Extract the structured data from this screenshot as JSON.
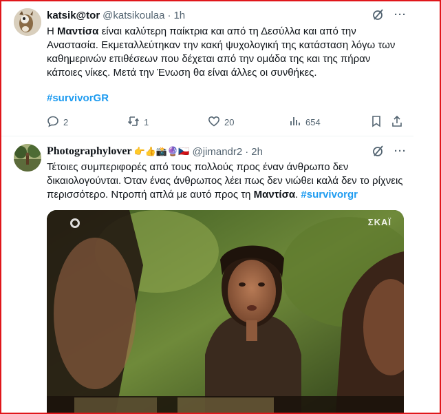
{
  "tweets": [
    {
      "display_name": "katsik@tor",
      "handle": "@katsikoulaa",
      "dot": "·",
      "time": "1h",
      "text": {
        "p1": "Η ",
        "bold1": "Μαντίσα",
        "p2": " είναι καλύτερη παίκτρια και από τη Δεσύλλα και από την Αναστασία. Εκμεταλλεύτηκαν την κακή ψυχολογική της κατάσταση λόγω των  καθημερινών επιθέσεων που δέχεται από την ομάδα της και της πήραν κάποιες νίκες. Μετά την Ένωση θα είναι άλλες οι συνθήκες."
      },
      "hashtag": "#survivorGR",
      "stats": {
        "replies": "2",
        "reposts": "1",
        "likes": "20",
        "views": "654"
      }
    },
    {
      "display_name": "Photographylover",
      "emojis": "👉👍📸🔮🇨🇿",
      "handle": "@jimandr2",
      "dot": "·",
      "time": "2h",
      "text": {
        "p1": "Τέτοιες συμπεριφορές από τους πολλούς προς έναν άνθρωπο δεν δικαιολογούνται. Όταν ένας άνθρωπος λέει πως δεν νιώθει καλά δεν το ρίχνεις περισσότερο. Ντροπή απλά με αυτό προς τη ",
        "bold1": "Μαντίσα",
        "p2": ". ",
        "hashtag": "#survivorgr"
      },
      "media": {
        "channel_logo": "ΣΚΑΪ"
      }
    }
  ],
  "colors": {
    "accent": "#1d9bf0",
    "text": "#0f1419",
    "muted": "#536471",
    "frame": "#e0161b"
  },
  "icons": [
    "grok-icon",
    "more-icon",
    "reply-icon",
    "repost-icon",
    "like-icon",
    "views-icon",
    "bookmark-icon",
    "share-icon"
  ]
}
